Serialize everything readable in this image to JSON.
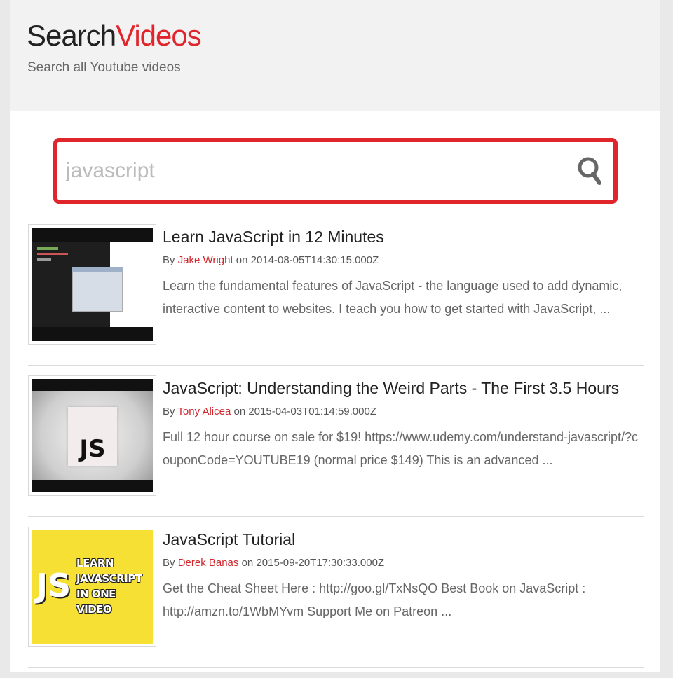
{
  "header": {
    "brand_part1": "Search",
    "brand_part2": "Videos",
    "tagline": "Search all Youtube videos",
    "brand_color": "#e0262c"
  },
  "search": {
    "placeholder": "javascript",
    "value": "",
    "icon": "search-icon"
  },
  "results": [
    {
      "title": "Learn JavaScript in 12 Minutes",
      "by_label": "By",
      "author": "Jake Wright",
      "on_label": "on",
      "date": "2014-08-05T14:30:15.000Z",
      "description": "Learn the fundamental features of JavaScript - the language used to add dynamic, interactive content to websites. I teach you how to get started with JavaScript, ..."
    },
    {
      "title": "JavaScript: Understanding the Weird Parts - The First 3.5 Hours",
      "by_label": "By",
      "author": "Tony Alicea",
      "on_label": "on",
      "date": "2015-04-03T01:14:59.000Z",
      "description": "Full 12 hour course on sale for $19! https://www.udemy.com/understand-javascript/?couponCode=YOUTUBE19 (normal price $149) This is an advanced ...",
      "thumb_text": "JS"
    },
    {
      "title": "JavaScript Tutorial",
      "by_label": "By",
      "author": "Derek Banas",
      "on_label": "on",
      "date": "2015-09-20T17:30:33.000Z",
      "description": "Get the Cheat Sheet Here : http://goo.gl/TxNsQO Best Book on JavaScript : http://amzn.to/1WbMYvm Support Me on Patreon ...",
      "thumb_js": "JS",
      "thumb_lines": [
        "LEARN",
        "JAVASCRIPT",
        "IN ONE",
        "VIDEO"
      ]
    }
  ]
}
